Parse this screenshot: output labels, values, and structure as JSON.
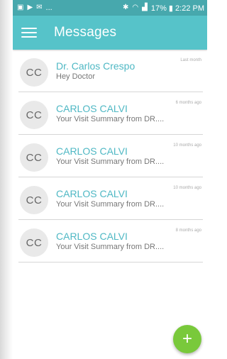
{
  "status_bar": {
    "left_icons": [
      "image-icon",
      "play-icon",
      "mail-icon"
    ],
    "left_more": "...",
    "right_text": "17% ▮ 2:22 PM",
    "right_icons": [
      "bluetooth-icon",
      "wifi-icon",
      "signal-icon"
    ]
  },
  "header": {
    "title": "Messages"
  },
  "messages": [
    {
      "avatar": "CC",
      "name": "Dr. Carlos Crespo",
      "preview": "Hey Doctor",
      "time": "Last month"
    },
    {
      "avatar": "CC",
      "name": "CARLOS  CALVI",
      "preview": "Your Visit Summary from DR....",
      "time": "6 months ago"
    },
    {
      "avatar": "CC",
      "name": "CARLOS  CALVI",
      "preview": "Your Visit Summary from DR....",
      "time": "10 months ago"
    },
    {
      "avatar": "CC",
      "name": "CARLOS  CALVI",
      "preview": "Your Visit Summary from DR....",
      "time": "10 months ago"
    },
    {
      "avatar": "CC",
      "name": "CARLOS  CALVI",
      "preview": "Your Visit Summary from DR....",
      "time": "8 months ago"
    }
  ],
  "fab": {
    "label": "+",
    "color": "#79c93b"
  },
  "colors": {
    "header": "#56c3c9",
    "status_bar": "#47a8ad",
    "name_text": "#4fb8c4"
  }
}
